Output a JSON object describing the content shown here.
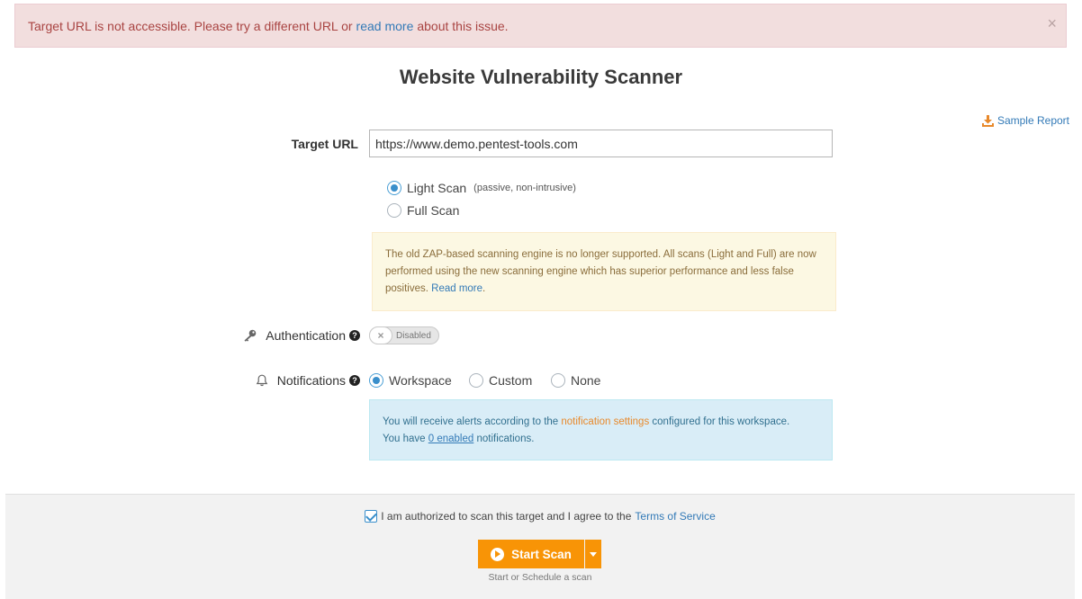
{
  "alert": {
    "text_before": "Target URL is not accessible. Please try a different URL or",
    "link": "read more",
    "text_after": "about this issue.",
    "close": "×"
  },
  "title": "Website Vulnerability Scanner",
  "sample_report": "Sample Report",
  "target": {
    "label": "Target URL",
    "value": "https://www.demo.pentest-tools.com"
  },
  "scan_types": [
    {
      "label": "Light Scan",
      "note": "(passive, non-intrusive)",
      "selected": true
    },
    {
      "label": "Full Scan",
      "note": "",
      "selected": false
    }
  ],
  "warning": {
    "text": "The old ZAP-based scanning engine is no longer supported. All scans (Light and Full) are now performed using the new scanning engine which has superior performance and less false positives.",
    "link": "Read more",
    "end": "."
  },
  "auth": {
    "label": "Authentication",
    "toggle": "Disabled",
    "toggle_icon": "×"
  },
  "notifications": {
    "label": "Notifications",
    "options": [
      "Workspace",
      "Custom",
      "None"
    ],
    "selected": "Workspace"
  },
  "info": {
    "t1": "You will receive alerts according to the",
    "link1": "notification settings",
    "t2": "configured for this workspace.",
    "t3": "You have",
    "link2": "0 enabled",
    "t4": "notifications."
  },
  "footer": {
    "agree_text": "I am authorized to scan this target and I agree to the",
    "terms_link": "Terms of Service",
    "start_label": "Start Scan",
    "hint": "Start or Schedule a scan"
  },
  "colors": {
    "accent": "#f89406",
    "link": "#337ab7",
    "error_bg": "#f2dede",
    "warning_bg": "#fcf8e3",
    "info_bg": "#d9edf7"
  }
}
